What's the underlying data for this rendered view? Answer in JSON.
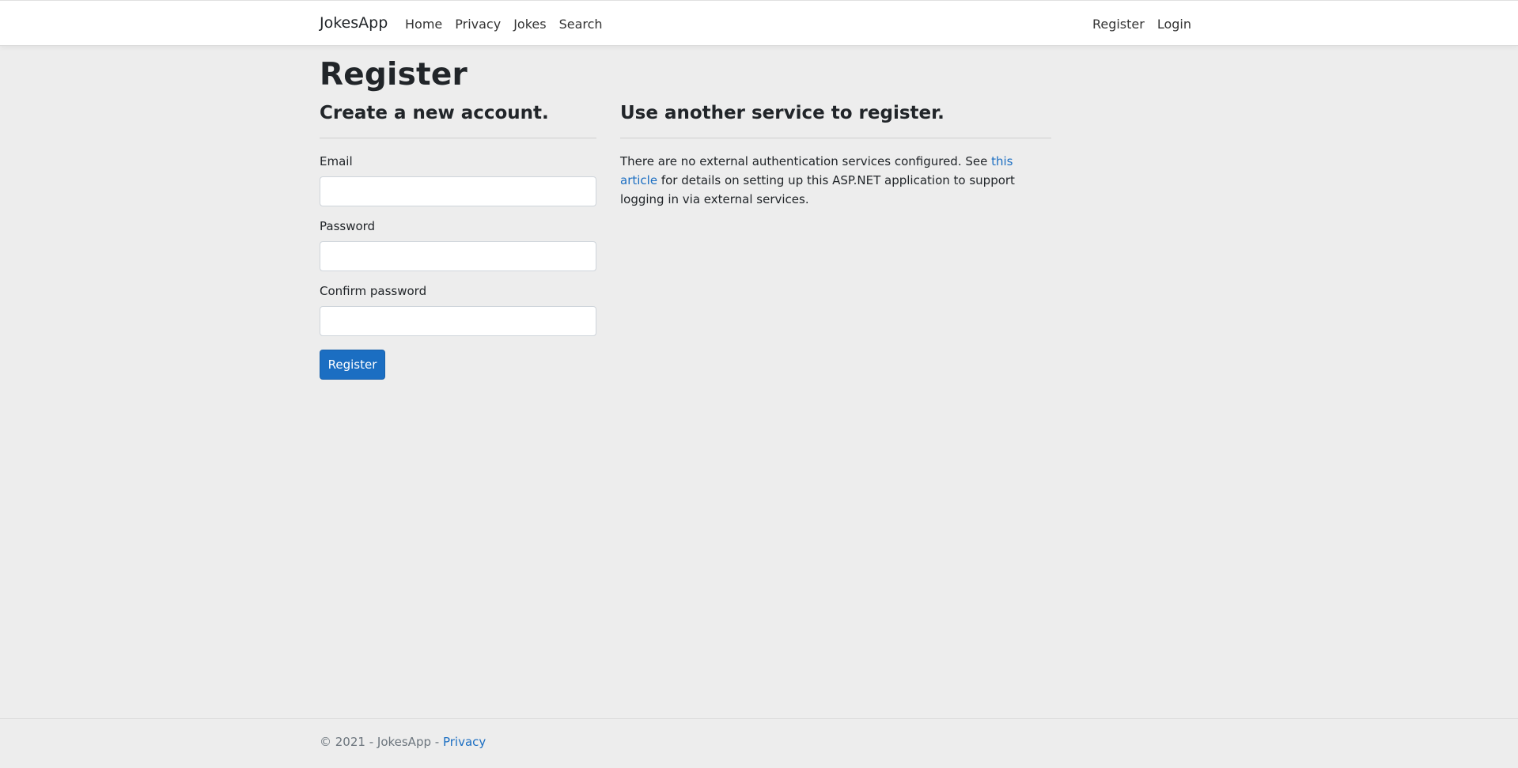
{
  "navbar": {
    "brand": "JokesApp",
    "left_links": [
      "Home",
      "Privacy",
      "Jokes",
      "Search"
    ],
    "right_links": [
      "Register",
      "Login"
    ]
  },
  "page": {
    "title": "Register"
  },
  "register_form": {
    "heading": "Create a new account.",
    "email_label": "Email",
    "email_value": "",
    "password_label": "Password",
    "password_value": "",
    "confirm_label": "Confirm password",
    "confirm_value": "",
    "submit_label": "Register"
  },
  "external": {
    "heading": "Use another service to register.",
    "text_before": "There are no external authentication services configured. See ",
    "link_text": "this article",
    "text_after": " for details on setting up this ASP.NET application to support logging in via external services."
  },
  "footer": {
    "copyright": "© 2021 - JokesApp - ",
    "privacy_link": "Privacy"
  },
  "colors": {
    "primary": "#1b6ec2",
    "background": "#ededed",
    "navbar": "#ffffff"
  }
}
